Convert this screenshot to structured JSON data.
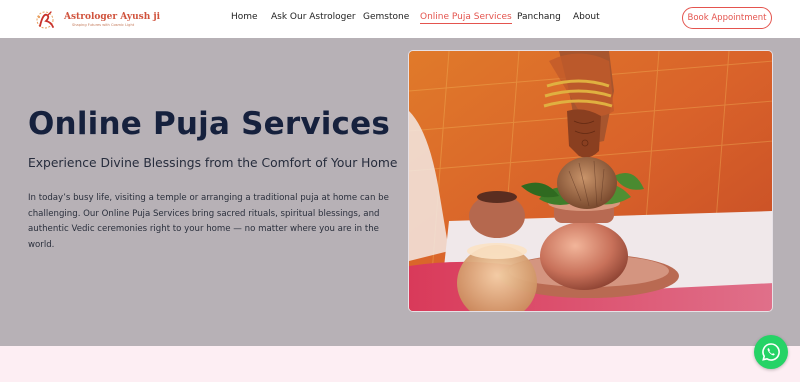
{
  "brand": {
    "name": "Astrologer Ayush ji",
    "tagline": "Shaping Futures with Cosmic Light",
    "logo_icon": "astro-monogram-icon"
  },
  "nav": {
    "items": [
      {
        "label": "Home",
        "active": false
      },
      {
        "label": "Ask Our Astrologer",
        "active": false
      },
      {
        "label": "Gemstone",
        "active": false
      },
      {
        "label": "Online Puja Services",
        "active": true
      },
      {
        "label": "Panchang",
        "active": false
      },
      {
        "label": "About",
        "active": false
      }
    ],
    "cta_label": "Book Appointment"
  },
  "hero": {
    "title": "Online Puja Services",
    "subtitle": "Experience Divine Blessings from the Comfort of Your Home",
    "body": "In today’s busy life, visiting a temple or arranging a traditional puja at home can be challenging. Our Online Puja Services bring sacred rituals, spiritual blessings, and authentic Vedic ceremonies right to your home — no matter where you are in the world.",
    "image_icon": "puja-kalash-photo"
  },
  "floating": {
    "whatsapp_icon": "whatsapp-icon"
  },
  "colors": {
    "accent": "#e4544e",
    "hero_bg": "#b7b1b6",
    "title": "#16213d",
    "page_bg": "#fdeef3",
    "whatsapp": "#25d366"
  }
}
